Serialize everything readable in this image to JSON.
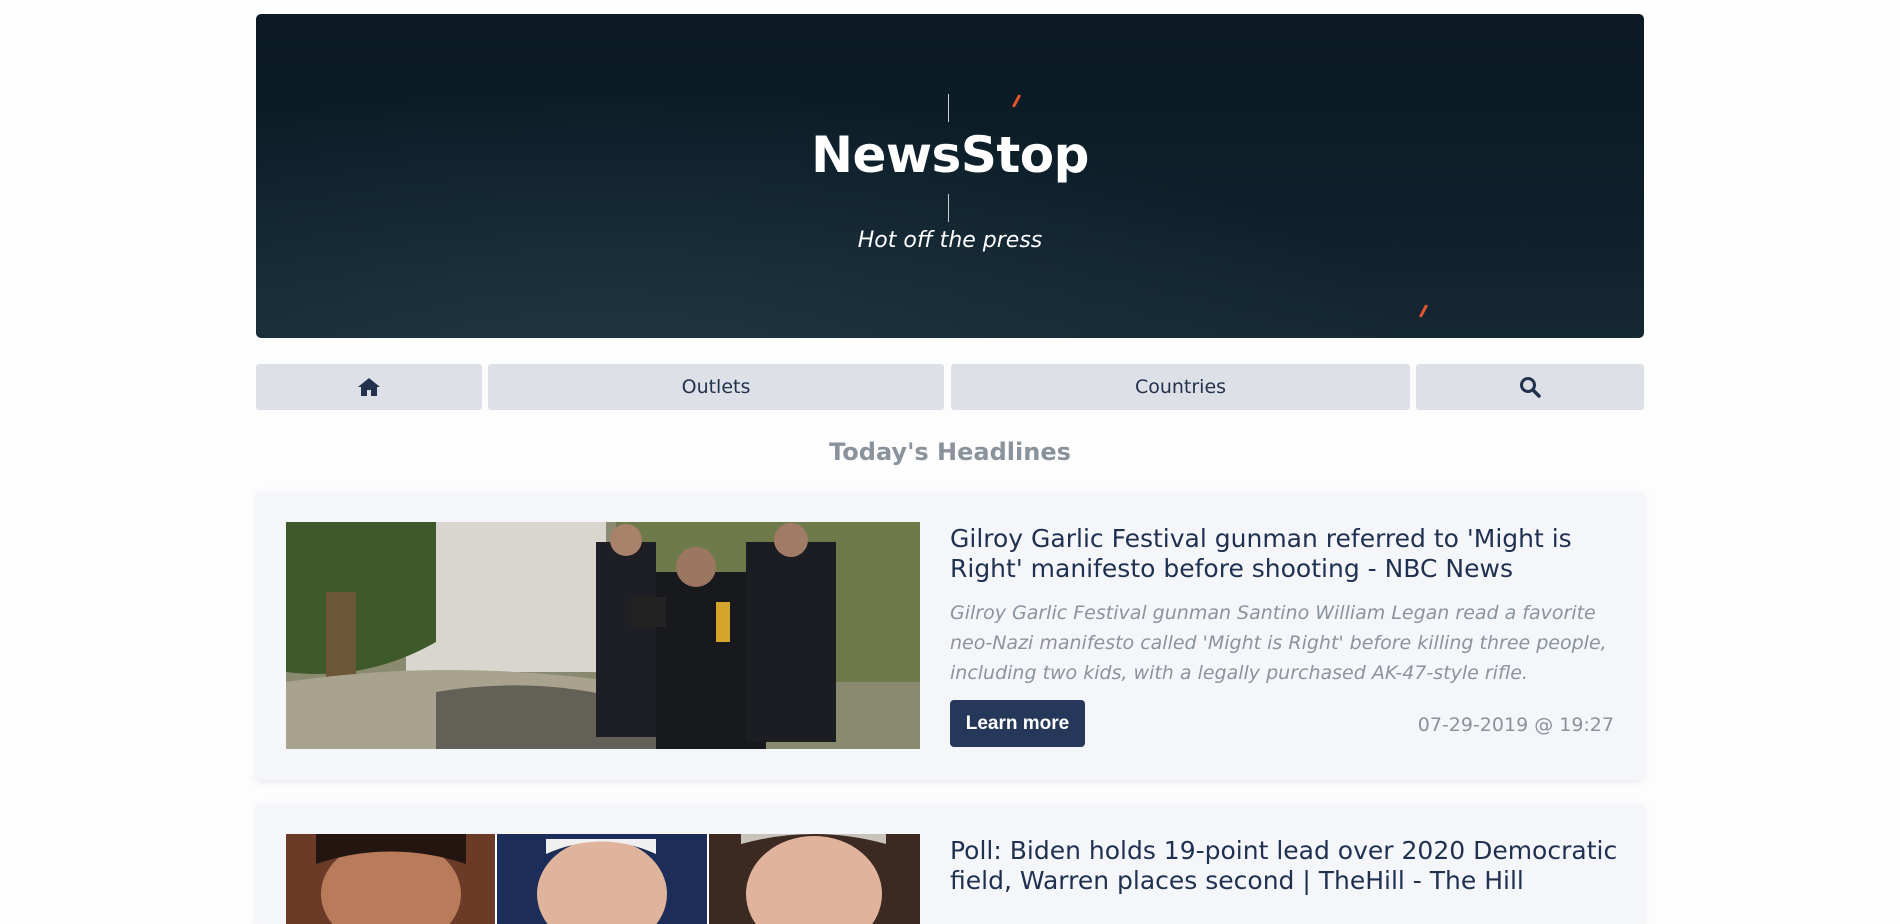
{
  "header": {
    "title": "NewsStop",
    "tagline": "Hot off the press"
  },
  "nav": {
    "home_icon": "home-icon",
    "outlets_label": "Outlets",
    "countries_label": "Countries",
    "search_icon": "search-icon"
  },
  "main": {
    "heading": "Today's Headlines",
    "articles": [
      {
        "title": "Gilroy Garlic Festival gunman referred to 'Might is Right' manifesto before shooting - NBC News",
        "description": "Gilroy Garlic Festival gunman Santino William Legan read a favorite neo-Nazi manifesto called 'Might is Right' before killing three people, including two kids, with a legally purchased AK-47-style rifle.",
        "button_label": "Learn more",
        "date": "07-29-2019 @ 19:27"
      },
      {
        "title": "Poll: Biden holds 19-point lead over 2020 Democratic field, Warren places second | TheHill - The Hill"
      }
    ]
  },
  "colors": {
    "accent": "#26385a",
    "nav_button_bg": "#dde1e7",
    "heading_gray": "#8a929c"
  }
}
